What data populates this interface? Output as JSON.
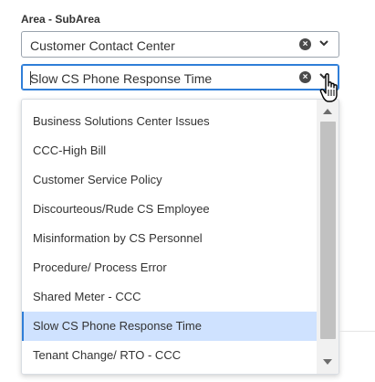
{
  "form": {
    "label": "Area - SubArea",
    "area_select": {
      "value": "Customer Contact Center",
      "clear_icon": "clear-icon",
      "chevron_icon": "chevron-down-icon"
    },
    "subarea_select": {
      "value": "Slow CS Phone Response Time",
      "clear_icon": "clear-icon",
      "chevron_icon": "chevron-down-icon"
    }
  },
  "dropdown": {
    "options": [
      "Business Solutions Center Issues",
      "CCC-High Bill",
      "Customer Service Policy",
      "Discourteous/Rude CS Employee",
      "Misinformation by CS Personnel",
      "Procedure/ Process Error",
      "Shared Meter - CCC",
      "Slow CS Phone Response Time",
      "Tenant Change/ RTO - CCC"
    ],
    "selected_option": "Slow CS Phone Response Time",
    "scroll_up_icon": "scroll-up-arrow-icon",
    "scroll_down_icon": "scroll-down-arrow-icon"
  },
  "cursor": {
    "icon": "hand-pointer-icon"
  },
  "colors": {
    "focus_border": "#2f7ed8",
    "selected_bg": "#cfe2ff",
    "border": "#9aa3ad"
  }
}
